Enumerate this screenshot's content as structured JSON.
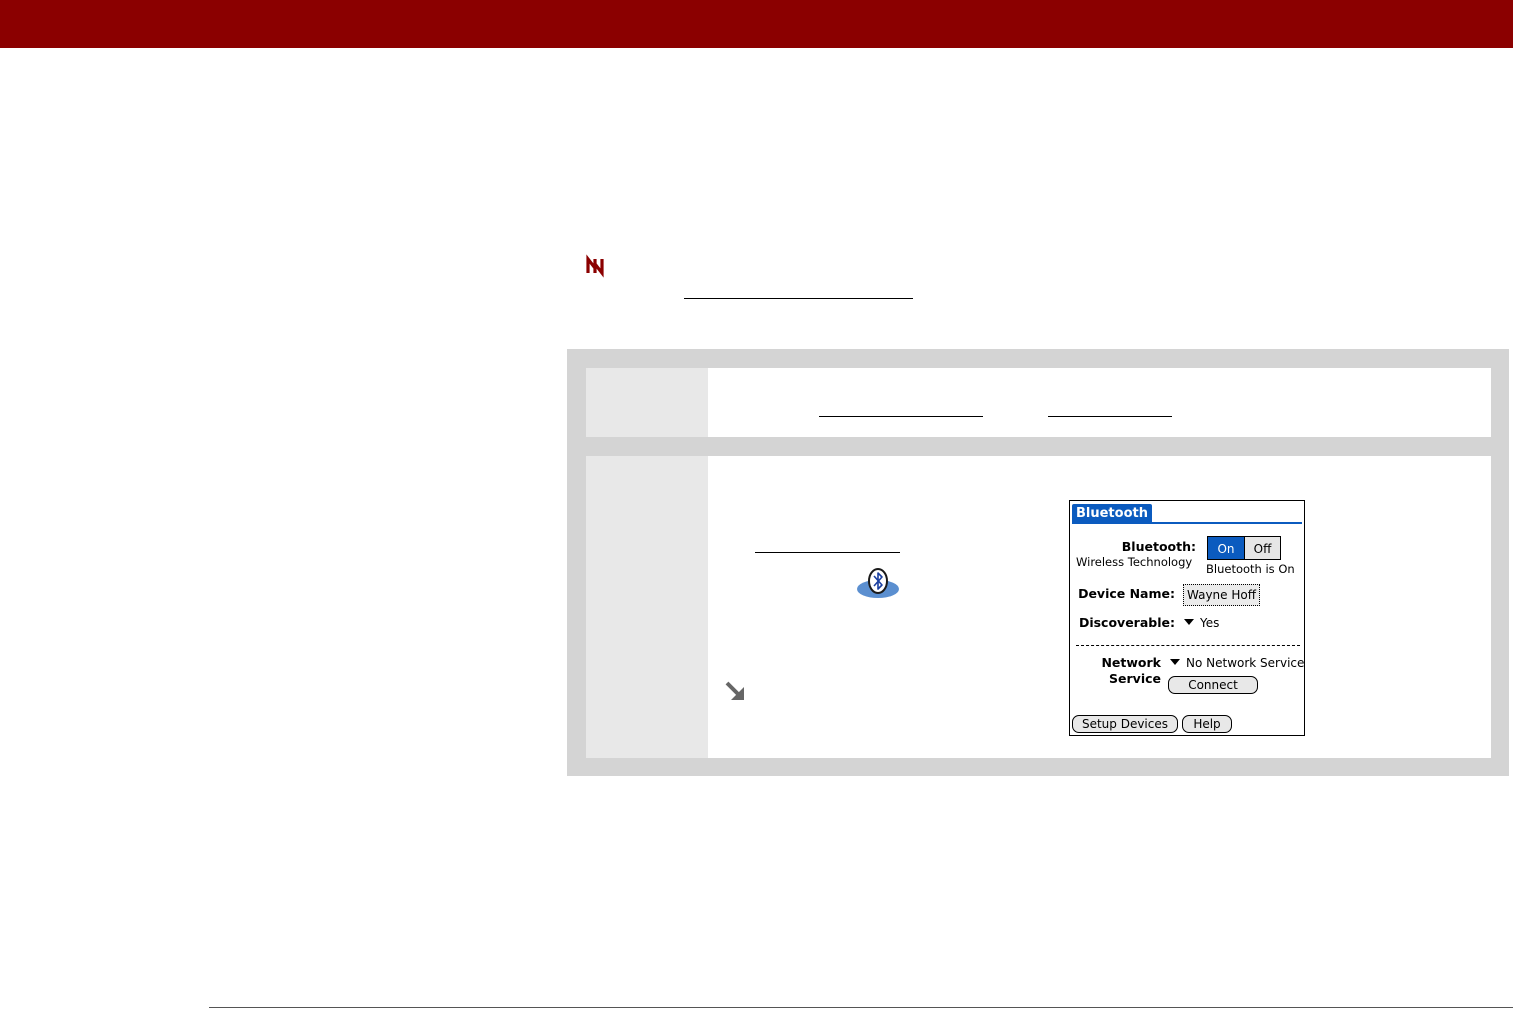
{
  "colors": {
    "header_bar": "#8b0000",
    "panel_gray": "#d4d4d4",
    "step_number_cell": "#e8e8e8",
    "palm_accent": "#0b5bbf"
  },
  "icons": {
    "note": "note-icon",
    "bluetooth": "bluetooth-app-icon",
    "tip": "tip-arrow-icon"
  },
  "palm_screen": {
    "title": "Bluetooth",
    "bluetooth_label": "Bluetooth:",
    "wireless_label": "Wireless Technology",
    "on_label": "On",
    "off_label": "Off",
    "status_text": "Bluetooth is On",
    "device_name_label": "Device Name:",
    "device_name_value": "Wayne Hoff",
    "discoverable_label": "Discoverable:",
    "discoverable_value": "Yes",
    "network_label": "Network",
    "service_label": "Service",
    "network_value": "No Network Service",
    "connect_button": "Connect",
    "setup_devices_button": "Setup Devices",
    "help_button": "Help"
  }
}
